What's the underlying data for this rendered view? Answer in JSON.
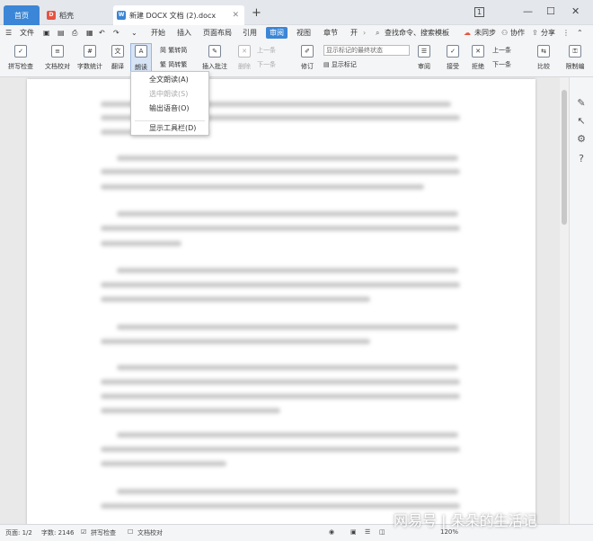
{
  "titlebar": {
    "tab_home": "首页",
    "tab_docer": "稻壳",
    "tab_doc": "新建 DOCX 文档 (2).docx",
    "doc_icon": "W",
    "docer_icon": "D",
    "page_badge": "1"
  },
  "menubar": {
    "file": "文件",
    "start": "开始",
    "insert": "插入",
    "layout": "页面布局",
    "reference": "引用",
    "review": "审阅",
    "view": "视图",
    "section": "章节",
    "dev": "开",
    "search": "查找命令、搜索模板",
    "sync": "未同步",
    "collab": "协作",
    "share": "分享"
  },
  "ribbon": {
    "spellcheck": "拼写检查",
    "proof": "文档校对",
    "wordcount": "字数统计",
    "translate": "翻译",
    "read": "朗读",
    "simp_to_trad": "繁转简",
    "trad_to_simp": "简转繁",
    "insert_comment": "插入批注",
    "delete": "删除",
    "prev": "上一条",
    "next": "下一条",
    "revise": "修订",
    "markup_dropdown": "显示标记的最终状态",
    "show_markup": "显示标记",
    "reviewer": "审阅",
    "accept": "接受",
    "reject": "拒绝",
    "prev2": "上一条",
    "next2": "下一条",
    "compare": "比较",
    "restrict": "限制编"
  },
  "dropdown": {
    "full_read": "全文朗读(A)",
    "select_read": "选中朗读(S)",
    "export_audio": "输出语音(O)",
    "show_toolbar": "显示工具栏(D)"
  },
  "statusbar": {
    "page": "页面: 1/2",
    "words": "字数: 2146",
    "spellcheck": "拼写检查",
    "proof": "文档校对",
    "zoom": "120%"
  },
  "watermark": "网易号 | 朵朵的生活记"
}
